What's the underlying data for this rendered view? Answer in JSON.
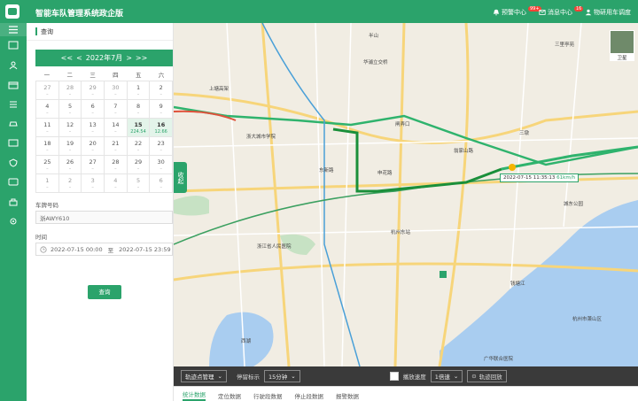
{
  "header": {
    "title": "智能车队管理系统政企版",
    "alerts_label": "预警中心",
    "alerts_badge": "99+",
    "messages_label": "消息中心",
    "messages_badge": "16",
    "user_label": "物研用车调度"
  },
  "panel": {
    "title": "查询",
    "calendar": {
      "nav": [
        "<<",
        "<",
        "2022年7月",
        ">",
        ">>"
      ],
      "weekdays": [
        "一",
        "二",
        "三",
        "四",
        "五",
        "六"
      ],
      "rows": [
        [
          {
            "d": "27",
            "s": "–"
          },
          {
            "d": "28",
            "s": "–"
          },
          {
            "d": "29",
            "s": "–"
          },
          {
            "d": "30",
            "s": "–"
          },
          {
            "d": "1",
            "s": "–"
          },
          {
            "d": "2",
            "s": "–"
          }
        ],
        [
          {
            "d": "4",
            "s": "–"
          },
          {
            "d": "5",
            "s": "–"
          },
          {
            "d": "6",
            "s": "–"
          },
          {
            "d": "7",
            "s": "–"
          },
          {
            "d": "8",
            "s": "–"
          },
          {
            "d": "9",
            "s": "–"
          }
        ],
        [
          {
            "d": "11",
            "s": "–"
          },
          {
            "d": "12",
            "s": "–"
          },
          {
            "d": "13",
            "s": "–"
          },
          {
            "d": "14",
            "s": "–"
          },
          {
            "d": "15",
            "s": "224.54"
          },
          {
            "d": "16",
            "s": "12.66"
          }
        ],
        [
          {
            "d": "18",
            "s": "–"
          },
          {
            "d": "19",
            "s": "–"
          },
          {
            "d": "20",
            "s": "–"
          },
          {
            "d": "21",
            "s": "–"
          },
          {
            "d": "22",
            "s": "–"
          },
          {
            "d": "23",
            "s": "–"
          }
        ],
        [
          {
            "d": "25",
            "s": "–"
          },
          {
            "d": "26",
            "s": "–"
          },
          {
            "d": "27",
            "s": "–"
          },
          {
            "d": "28",
            "s": "–"
          },
          {
            "d": "29",
            "s": "–"
          },
          {
            "d": "30",
            "s": "–"
          }
        ],
        [
          {
            "d": "1",
            "s": "–"
          },
          {
            "d": "2",
            "s": "–"
          },
          {
            "d": "3",
            "s": "–"
          },
          {
            "d": "4",
            "s": "–"
          },
          {
            "d": "5",
            "s": "–"
          },
          {
            "d": "6",
            "s": "–"
          }
        ]
      ]
    },
    "plate_label": "车牌号码",
    "plate_value": "浙AWY610",
    "time_label": "时间",
    "time_start": "2022-07-15 00:00",
    "time_sep": "至",
    "time_end": "2022-07-15 23:59",
    "query_button": "查询"
  },
  "map": {
    "collapse_label": "收起",
    "satellite_label": "卫星",
    "car_time": "2022-07-15 11:35:13",
    "car_speed": "61km/h",
    "places": [
      "华浦立交桥",
      "上塘高架",
      "浙大城市学院",
      "东新路",
      "半山",
      "翁家山路",
      "申花路",
      "闸弄口",
      "杭州东站",
      "三墩",
      "三里亭苑",
      "城东公园",
      "钱塘江",
      "浙江省人民医院",
      "西湖",
      "杭州市萧山区",
      "广华联合医院"
    ]
  },
  "toolbar": {
    "track_mgmt": "轨迹点管理",
    "stop_label": "停留标示",
    "stop_value": "15分钟",
    "speed_label": "播放速度",
    "speed_value": "1倍速",
    "replay_button": "轨迹回放"
  },
  "tabs": [
    "统计数据",
    "定位数据",
    "行驶段数据",
    "停止段数据",
    "报警数据"
  ],
  "colors": {
    "brand": "#2ba36b",
    "route": "#1a8f3a"
  }
}
